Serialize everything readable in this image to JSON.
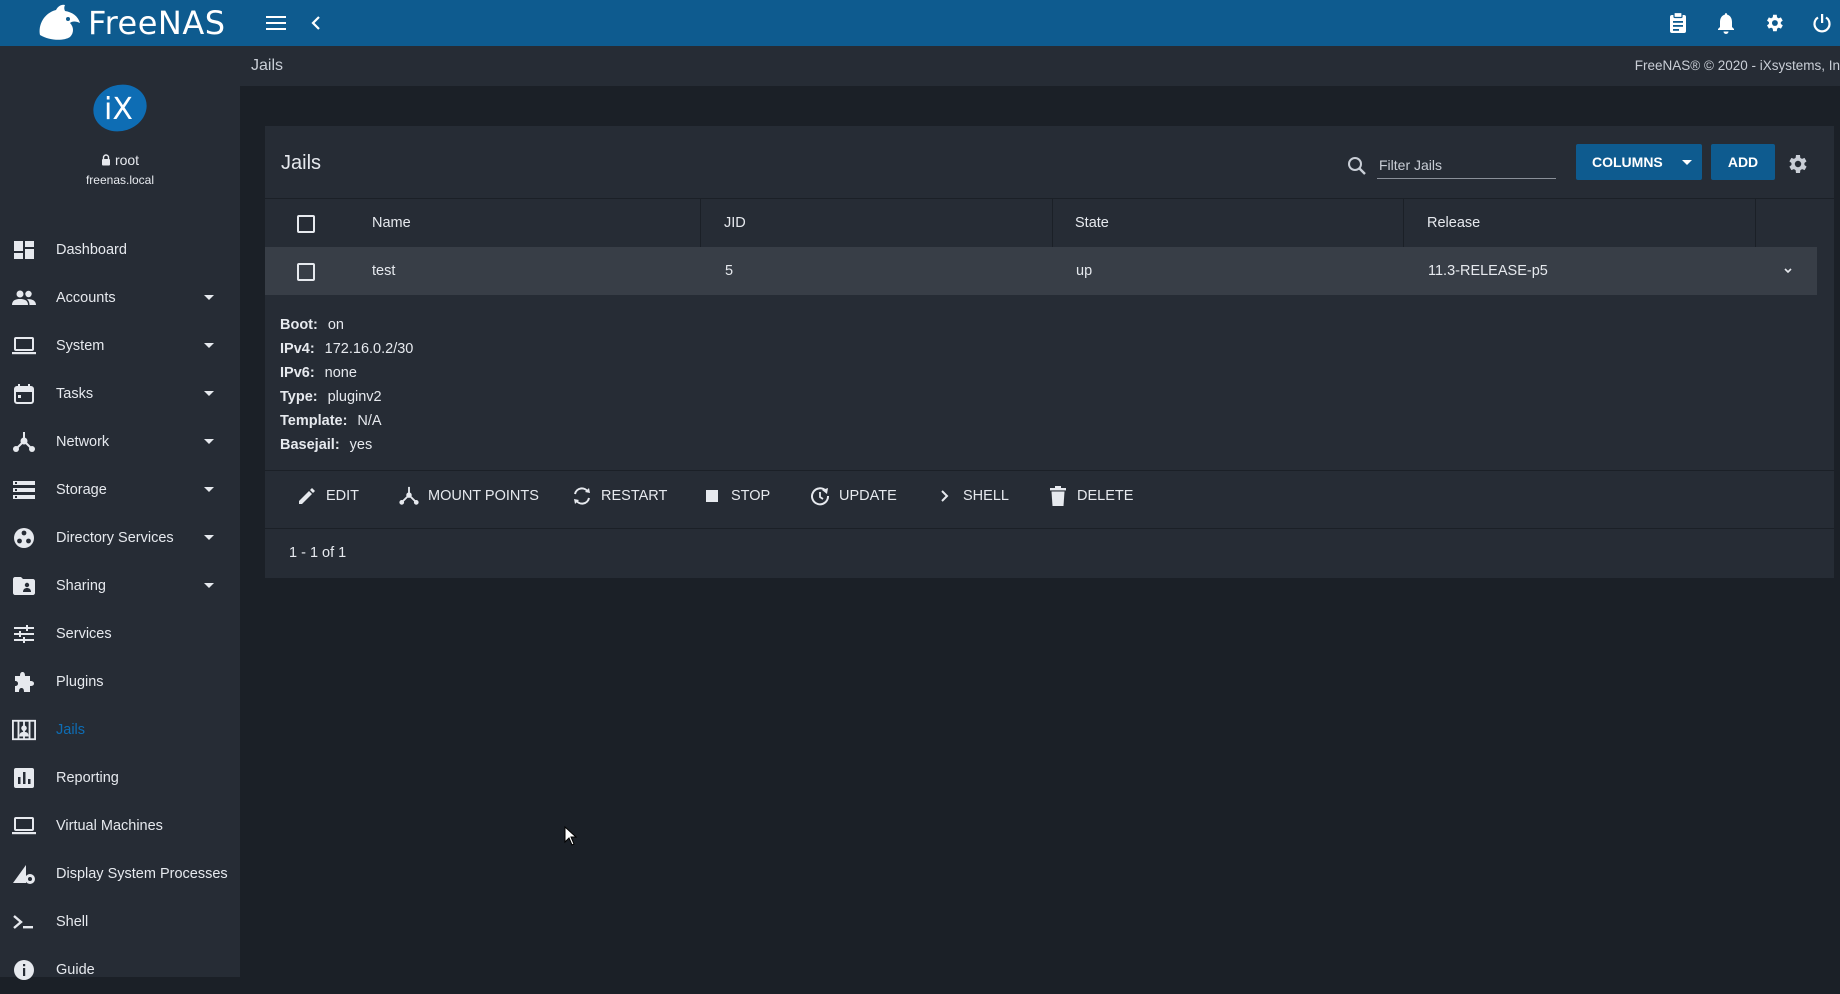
{
  "app": {
    "brand": "FreeNAS",
    "copyright": "FreeNAS® © 2020 - iXsystems, In",
    "accent_color": "#0e5b8f"
  },
  "topbar": {
    "icons": [
      "menu-icon",
      "chevron-left-icon",
      "clipboard-icon",
      "bell-icon",
      "gear-icon",
      "power-icon"
    ]
  },
  "profile": {
    "avatar_text": "iX",
    "user": "root",
    "host": "freenas.local"
  },
  "sidebar": {
    "items": [
      {
        "label": "Dashboard",
        "icon": "dashboard-icon",
        "expandable": false
      },
      {
        "label": "Accounts",
        "icon": "people-icon",
        "expandable": true
      },
      {
        "label": "System",
        "icon": "laptop-icon",
        "expandable": true
      },
      {
        "label": "Tasks",
        "icon": "calendar-icon",
        "expandable": true
      },
      {
        "label": "Network",
        "icon": "network-icon",
        "expandable": true
      },
      {
        "label": "Storage",
        "icon": "storage-icon",
        "expandable": true
      },
      {
        "label": "Directory Services",
        "icon": "directory-icon",
        "expandable": true
      },
      {
        "label": "Sharing",
        "icon": "shared-folder-icon",
        "expandable": true
      },
      {
        "label": "Services",
        "icon": "sliders-icon",
        "expandable": false
      },
      {
        "label": "Plugins",
        "icon": "puzzle-icon",
        "expandable": false
      },
      {
        "label": "Jails",
        "icon": "jail-icon",
        "expandable": false,
        "active": true
      },
      {
        "label": "Reporting",
        "icon": "bar-chart-icon",
        "expandable": false
      },
      {
        "label": "Virtual Machines",
        "icon": "laptop-icon",
        "expandable": false
      },
      {
        "label": "Display System Processes",
        "icon": "processes-icon",
        "expandable": false
      },
      {
        "label": "Shell",
        "icon": "terminal-icon",
        "expandable": false
      },
      {
        "label": "Guide",
        "icon": "info-icon",
        "expandable": false
      }
    ]
  },
  "breadcrumb": "Jails",
  "card": {
    "title": "Jails",
    "search_placeholder": "Filter Jails",
    "columns_label": "COLUMNS",
    "add_label": "ADD"
  },
  "table": {
    "headers": [
      "Name",
      "JID",
      "State",
      "Release"
    ],
    "rows": [
      {
        "name": "test",
        "jid": "5",
        "state": "up",
        "release": "11.3-RELEASE-p5"
      }
    ]
  },
  "details": [
    {
      "key": "Boot:",
      "value": "on"
    },
    {
      "key": "IPv4:",
      "value": "172.16.0.2/30"
    },
    {
      "key": "IPv6:",
      "value": "none"
    },
    {
      "key": "Type:",
      "value": "pluginv2"
    },
    {
      "key": "Template:",
      "value": "N/A"
    },
    {
      "key": "Basejail:",
      "value": "yes"
    }
  ],
  "actions": [
    {
      "label": "EDIT",
      "icon": "pencil-icon"
    },
    {
      "label": "MOUNT POINTS",
      "icon": "mount-points-icon"
    },
    {
      "label": "RESTART",
      "icon": "restart-icon"
    },
    {
      "label": "STOP",
      "icon": "stop-icon"
    },
    {
      "label": "UPDATE",
      "icon": "update-icon"
    },
    {
      "label": "SHELL",
      "icon": "chevron-right-icon"
    },
    {
      "label": "DELETE",
      "icon": "trash-icon"
    }
  ],
  "pager": "1 - 1 of 1"
}
